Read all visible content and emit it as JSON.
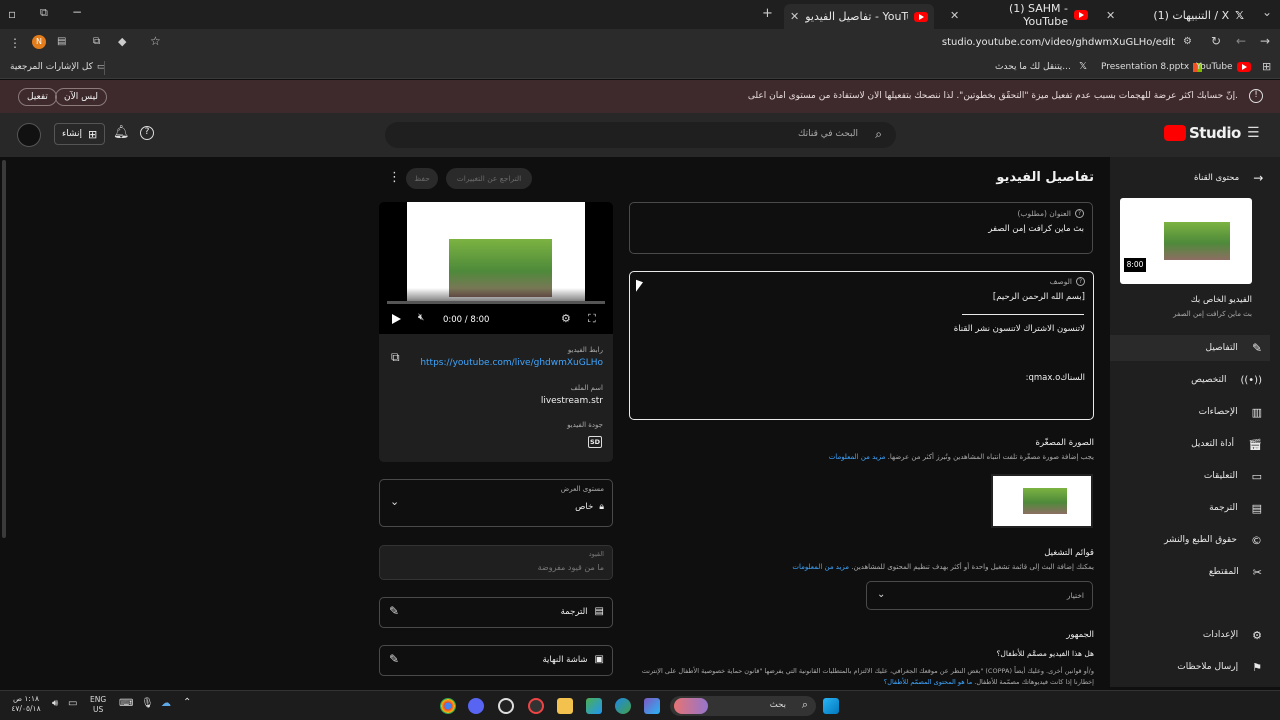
{
  "tabs": [
    {
      "title": "(1) التنبيهات / X"
    },
    {
      "title": "(1) SAHM - YouTube"
    },
    {
      "title": "تفاصيل الفيديو - YouTube Studio"
    }
  ],
  "address": {
    "url": "studio.youtube.com/video/ghdwmXuGLHo/edit"
  },
  "bookmarks": {
    "items": [
      "YouTube",
      "Presentation 8.pptx",
      "يتنقل لك ما يحدث...",
      "X"
    ],
    "all_label": "كل الإشارات المرجعية"
  },
  "banner": {
    "message": "إنّ حسابك أكثر عرضة للهجمات بسبب عدم تفعيل ميزة \"التحقّق بخطوتين\". لذا ننصحك بتفعيلها الآن لاستفادة من مستوى أمان أعلى.",
    "enable_label": "تفعيل",
    "later_label": "ليس الآن"
  },
  "header": {
    "brand": "Studio",
    "search_placeholder": "البحث في قناتك",
    "create_label": "إنشاء"
  },
  "sidenav": {
    "back_label": "محتوى القناة",
    "thumb_duration": "8:00",
    "your_video_label": "الفيديو الخاص بك",
    "video_title": "بث ماين كرافت إمن الصفر",
    "items": [
      {
        "label": "التفاصيل"
      },
      {
        "label": "التخصيص"
      },
      {
        "label": "الإحصاءات"
      },
      {
        "label": "أداة التعديل"
      },
      {
        "label": "التعليقات"
      },
      {
        "label": "الترجمة"
      },
      {
        "label": "حقوق الطبع والنشر"
      },
      {
        "label": "المقتطع"
      }
    ],
    "settings_label": "الإعدادات",
    "feedback_label": "إرسال ملاحظات"
  },
  "page": {
    "title": "تفاصيل الفيديو",
    "undo_label": "التراجع عن التغييرات",
    "save_label": "حفظ"
  },
  "title_field": {
    "label": "العنوان (مطلوب)",
    "value": "بث ماين كرافت إمن الصفر"
  },
  "description_field": {
    "label": "الوصف",
    "line1": "[بسم الله الرحمن الرحيم]",
    "line2": "لاتنسون الاشتراك لاتنسون نشر القناة",
    "line3": ":qmax.oالسناك"
  },
  "thumbnail": {
    "heading": "الصورة المصغّرة",
    "help": "يجب إضافة صورة مصغّرة تلفت انتباه المشاهدين وتُبرز أكثر من عرضها.",
    "more": "مزيد من المعلومات"
  },
  "playlists": {
    "heading": "قوائم التشغيل",
    "help": "يمكنك إضافة البث إلى قائمة تشغيل واحدة أو أكثر بهدف تنظيم المحتوى للمشاهدين.",
    "more": "مزيد من المعلومات",
    "select_label": "اختيار"
  },
  "audience": {
    "heading": "الجمهور",
    "question": "هل هذا الفيديو مصمَّم للأطفال؟",
    "help": "بغض النظر عن موقعك الجغرافي، عليك الالتزام بالمتطلبات القانونية التي يفرضها \"قانون حماية خصوصية الأطفال على الإنترنت\" (COPPA) و/أو قوانين أخرى. وعليك أيضاً إخطارنا إذا كانت فيديوهاتك مصمّمة للأطفال.",
    "link": "ما هو المحتوى المصمّم للأطفال؟"
  },
  "player": {
    "time": "0:00 / 8:00",
    "progress": 0
  },
  "video_info": {
    "link_label": "رابط الفيديو",
    "link_value": "https://youtube.com/live/ghdwmXuGLHo",
    "file_label": "اسم الملف",
    "file_value": "livestream.str",
    "quality_label": "جودة الفيديو",
    "quality_value": "SD"
  },
  "visibility": {
    "label": "مستوى العرض",
    "value": "خاص"
  },
  "restrictions": {
    "label": "القيود",
    "value": "ما من قيود مفروضة"
  },
  "subtitles": {
    "label": "الترجمة"
  },
  "endscreen": {
    "label": "شاشة النهاية"
  },
  "taskbar": {
    "search_label": "بحث",
    "lang": "ENG",
    "region": "US",
    "time": "١:١٨ ص",
    "date": "٤٧/٠٥/١٨"
  },
  "colors": {
    "accent": "#3ea6ff",
    "brand": "#ff0000",
    "banner": "#3e2a2d"
  }
}
